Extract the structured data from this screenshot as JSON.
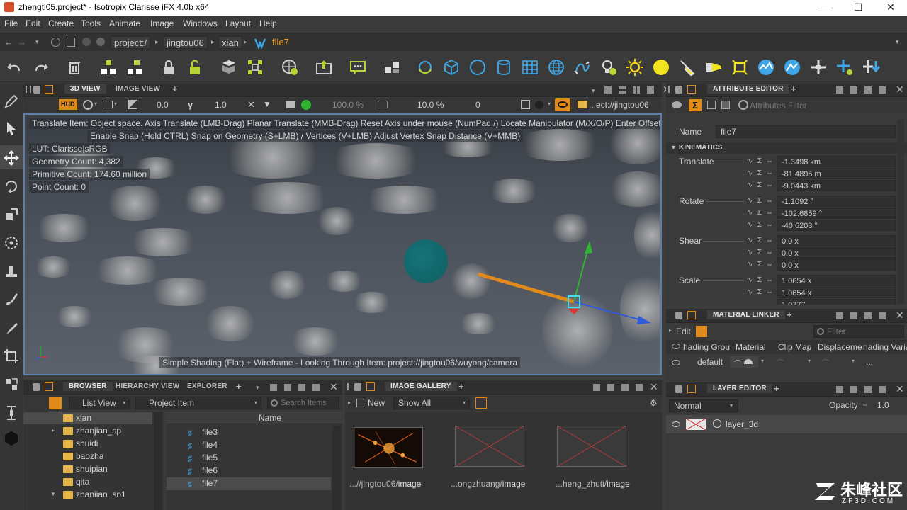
{
  "window": {
    "title": "zhengti05.project* - Isotropix Clarisse iFX 4.0b x64",
    "controls": [
      "—",
      "☐",
      "✕"
    ]
  },
  "menu": [
    "File",
    "Edit",
    "Create",
    "Tools",
    "Animate",
    "Image",
    "Windows",
    "Layout",
    "Help"
  ],
  "path": {
    "crumbs": [
      "project:/",
      "jingtou06",
      "xian"
    ],
    "current": "file7"
  },
  "viewport_panel": {
    "tabs": [
      "3D VIEW",
      "IMAGE VIEW",
      "+"
    ],
    "toolbar": {
      "hud": "HUD",
      "exposure": "0.0",
      "gamma": "1.0",
      "zoom_pct": "100.0 %",
      "scale_pct": "10.0 %",
      "frame": "0",
      "camera_path": "...ect://jingtou06"
    },
    "help_line1": "Translate Item: Object space. Axis Translate (LMB-Drag)  Planar Translate (MMB-Drag) Reset Axis under mouse (NumPad /)  Locate Manipulator (M/X/O/P)  Enter Offset (",
    "help_line2": "Enable Snap (Hold CTRL) Snap on Geometry (S+LMB) / Vertices (V+LMB) Adjust Vertex Snap Distance (V+MMB)",
    "stats": [
      "LUT: Clarisse|sRGB",
      "Geometry Count: 4,382",
      "Primitive Count: 174.60 million",
      "Point Count: 0"
    ],
    "footer": "Simple Shading (Flat) + Wireframe - Looking Through Item: project://jingtou06/wuyong/camera"
  },
  "attribute_editor": {
    "tab": "ATTRIBUTE EDITOR",
    "filter_placeholder": "Attributes Filter",
    "name_label": "Name",
    "name_value": "file7",
    "section": "KINEMATICS",
    "groups": [
      {
        "label": "Translate",
        "values": [
          "-1.3498 km",
          "-81.4895 m",
          "-9.0443 km"
        ]
      },
      {
        "label": "Rotate",
        "values": [
          "-1.1092 °",
          "-102.6859 °",
          "-40.6203 °"
        ]
      },
      {
        "label": "Shear",
        "values": [
          "0.0 x",
          "0.0 x",
          "0.0 x"
        ]
      },
      {
        "label": "Scale",
        "values": [
          "1.0654 x",
          "1.0654 x",
          "1.0777"
        ]
      }
    ]
  },
  "material_linker": {
    "tab": "MATERIAL LINKER",
    "edit_label": "Edit",
    "filter_placeholder": "Filter",
    "columns": [
      "hading Grou",
      "Material",
      "Clip Map",
      "Displaceme",
      "nading Varia"
    ],
    "row_label": "default",
    "row_more": "..."
  },
  "layer_editor": {
    "tab": "LAYER EDITOR",
    "blend_mode": "Normal",
    "opacity_label": "Opacity",
    "opacity_value": "1.0",
    "layer_name": "layer_3d"
  },
  "browser": {
    "tabs": [
      "BROWSER",
      "HIERARCHY VIEW",
      "EXPLORER",
      "+"
    ],
    "view_mode": "List View",
    "item_type": "Project Item",
    "search_placeholder": "Search Items",
    "tree": [
      "xian",
      "zhanjian_sp",
      "shuidi",
      "baozha",
      "shuipian",
      "qita",
      "zhanjian_sp1"
    ],
    "column_name": "Name",
    "items": [
      "file3",
      "file4",
      "file5",
      "file6",
      "file7"
    ]
  },
  "image_gallery": {
    "tab": "IMAGE GALLERY",
    "new_label": "New",
    "filter": "Show All",
    "thumbs": [
      {
        "prefix": "...//jingtou06/",
        "name": "image"
      },
      {
        "prefix": "...ongzhuang/",
        "name": "image"
      },
      {
        "prefix": "...heng_zhuti/",
        "name": "image"
      }
    ]
  },
  "watermark": {
    "brand": "朱峰社区",
    "site": "ZF3D.COM"
  },
  "colors": {
    "accent_orange": "#f29e1f",
    "viewport_border": "#5d7ea7",
    "axis_x": "#2f5bd8",
    "axis_y": "#2fb52f",
    "axis_z": "#e08a1a",
    "sphere": "#0f5f63"
  }
}
